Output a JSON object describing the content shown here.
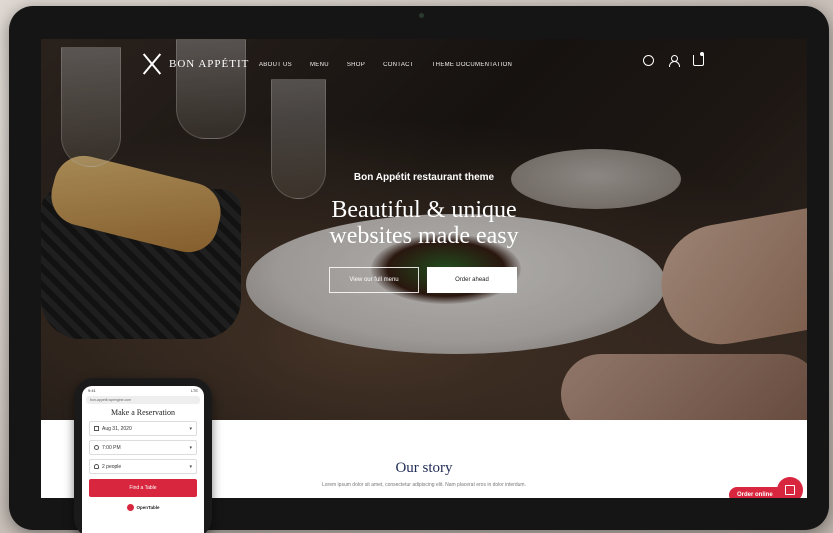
{
  "nav": {
    "brand": "BON APPÉTIT",
    "menu": [
      "ABOUT US",
      "MENU",
      "SHOP",
      "CONTACT",
      "THEME DOCUMENTATION"
    ]
  },
  "hero": {
    "kicker": "Bon Appétit restaurant theme",
    "headline_line1": "Beautiful & unique",
    "headline_line2": "websites made easy",
    "primary_button": "View our full menu",
    "secondary_button": "Order ahead"
  },
  "story": {
    "title": "Our story",
    "body": "Lorem ipsum dolor sit amet, consectetur adipiscing elit. Nam placerat eros in dolor interdum."
  },
  "order_widget": {
    "label": "Order online"
  },
  "phone": {
    "time": "9:41",
    "status_right": "LTE",
    "url": "bon-appetit.wpengine.com",
    "title": "Make a Reservation",
    "date": "Aug 31, 2020",
    "time_slot": "7:00 PM",
    "party": "2 people",
    "find_button": "Find a Table",
    "powered_by": "OpenTable"
  },
  "colors": {
    "accent": "#d7263d",
    "heading": "#1f2a55"
  }
}
